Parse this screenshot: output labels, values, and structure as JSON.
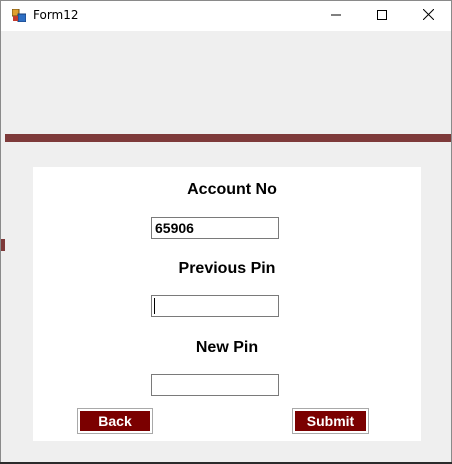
{
  "window": {
    "title": "Form12",
    "icons": {
      "app": "form-app-icon",
      "minimize": "minimize-icon",
      "maximize": "maximize-icon",
      "close": "close-icon"
    }
  },
  "colors": {
    "accent_bar": "#7e3a3a",
    "button_bg": "#7b0000",
    "button_text": "#ffffff",
    "client_bg": "#efefef",
    "panel_bg": "#ffffff"
  },
  "form": {
    "account_label": "Account No",
    "account_value": "65906",
    "previous_pin_label": "Previous Pin",
    "previous_pin_value": "",
    "new_pin_label": "New Pin",
    "new_pin_value": "",
    "back_button": "Back",
    "submit_button": "Submit"
  }
}
